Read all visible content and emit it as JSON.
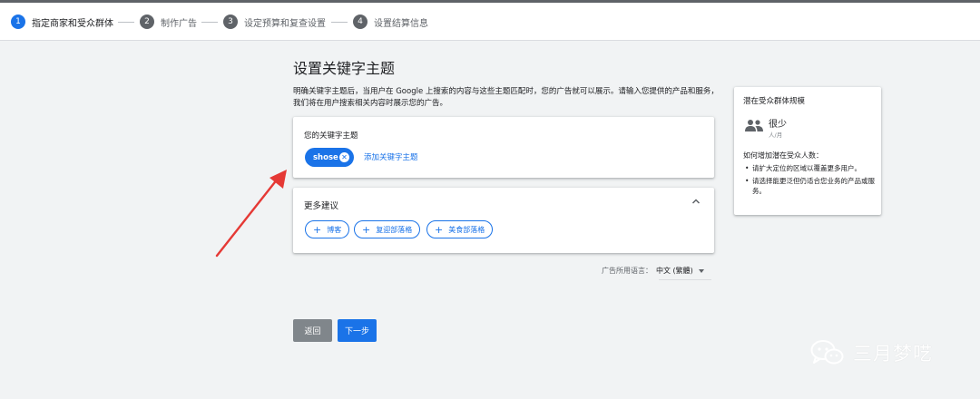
{
  "stepper": {
    "steps": [
      {
        "num": "1",
        "label": "指定商家和受众群体"
      },
      {
        "num": "2",
        "label": "制作广告"
      },
      {
        "num": "3",
        "label": "设定预算和复查设置"
      },
      {
        "num": "4",
        "label": "设置结算信息"
      }
    ]
  },
  "main": {
    "title": "设置关键字主题",
    "description": "明确关键字主题后，当用户在 Google 上搜索的内容与这些主题匹配时，您的广告就可以展示。请输入您提供的产品和服务，我们将在用户搜索相关内容时展示您的广告。",
    "keyword_card": {
      "label": "您的关键字主题",
      "chip": "shose",
      "add_link": "添加关键字主题"
    },
    "suggestions": {
      "title": "更多建议",
      "chips": [
        "博客",
        "复迎部落格",
        "美食部落格"
      ]
    },
    "language": {
      "label": "广告所用语言：",
      "value": "中文 (繁體)"
    },
    "buttons": {
      "back": "返回",
      "next": "下一步"
    }
  },
  "sidebar": {
    "title": "潜在受众群体规模",
    "value": "很少",
    "unit": "人/月",
    "subtitle": "如何增加潜在受众人数：",
    "tips": [
      "请扩大定位的区域以覆盖更多用户。",
      "请选择能更泛但仍适合您业务的产品或服务。"
    ]
  },
  "watermark": {
    "text": "三月梦呓"
  },
  "colors": {
    "accent": "#1a73e8",
    "annotation_arrow": "#e53935"
  }
}
